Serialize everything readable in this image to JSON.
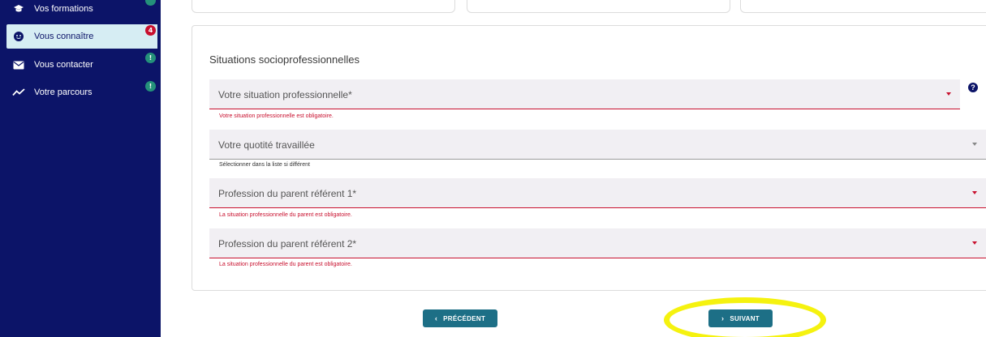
{
  "sidebar": {
    "items": [
      {
        "label": "Vos formations",
        "icon": "graduation-cap-icon"
      },
      {
        "label": "Vous connaître",
        "icon": "smiley-face-icon",
        "badge": "4"
      },
      {
        "label": "Vous contacter",
        "icon": "envelope-icon",
        "badge": "!"
      },
      {
        "label": "Votre parcours",
        "icon": "trend-line-icon",
        "badge": "!"
      }
    ]
  },
  "section": {
    "title": "Situations socioprofessionnelles",
    "fields": [
      {
        "label": "Votre situation professionnelle*",
        "message": "Votre situation professionnelle est obligatoire."
      },
      {
        "label": "Votre quotité travaillée",
        "message": "Sélectionner dans la liste si différent"
      },
      {
        "label": "Profession du parent référent 1*",
        "message": "La situation professionnelle du parent est obligatoire."
      },
      {
        "label": "Profession du parent référent 2*",
        "message": "La situation professionnelle du parent est obligatoire."
      }
    ],
    "help": "?"
  },
  "buttons": {
    "previous": "PRÉCÉDENT",
    "next": "SUIVANT"
  },
  "colors": {
    "sidebar": "#0c1468",
    "error": "#c8102e",
    "button": "#1d6f86",
    "highlight": "#f5f20f"
  }
}
